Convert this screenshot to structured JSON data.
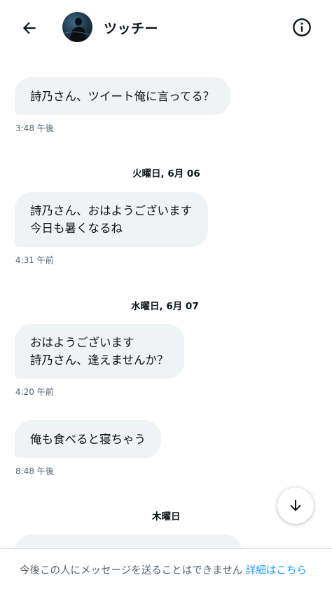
{
  "header": {
    "back_icon": "arrow-left-icon",
    "contact_name": "ツッチー",
    "info_icon": "info-circle-icon"
  },
  "conversation": [
    {
      "type": "message",
      "lines": [
        "詩乃さん、ツイート俺に言ってる？"
      ],
      "time": "3:48 午後"
    },
    {
      "type": "date",
      "label": "火曜日, 6月 06"
    },
    {
      "type": "message",
      "lines": [
        "詩乃さん、おはようございます",
        "今日も暑くなるね"
      ],
      "time": "4:31 午前"
    },
    {
      "type": "date",
      "label": "水曜日, 6月 07"
    },
    {
      "type": "message",
      "lines": [
        "おはようございます",
        "詩乃さん、逢えませんか？"
      ],
      "time": "4:20 午前"
    },
    {
      "type": "message",
      "lines": [
        "俺も食べると寝ちゃう"
      ],
      "time": "8:48 午後"
    },
    {
      "type": "date",
      "label": "木曜日"
    }
  ],
  "scroll_down_icon": "arrow-down-icon",
  "footer": {
    "notice": "今後この人にメッセージを送ることはできません",
    "link_label": "詳細はこちら"
  },
  "colors": {
    "bubble_bg": "#eff3f4",
    "link": "#1d9bf0",
    "secondary_text": "#536471"
  }
}
